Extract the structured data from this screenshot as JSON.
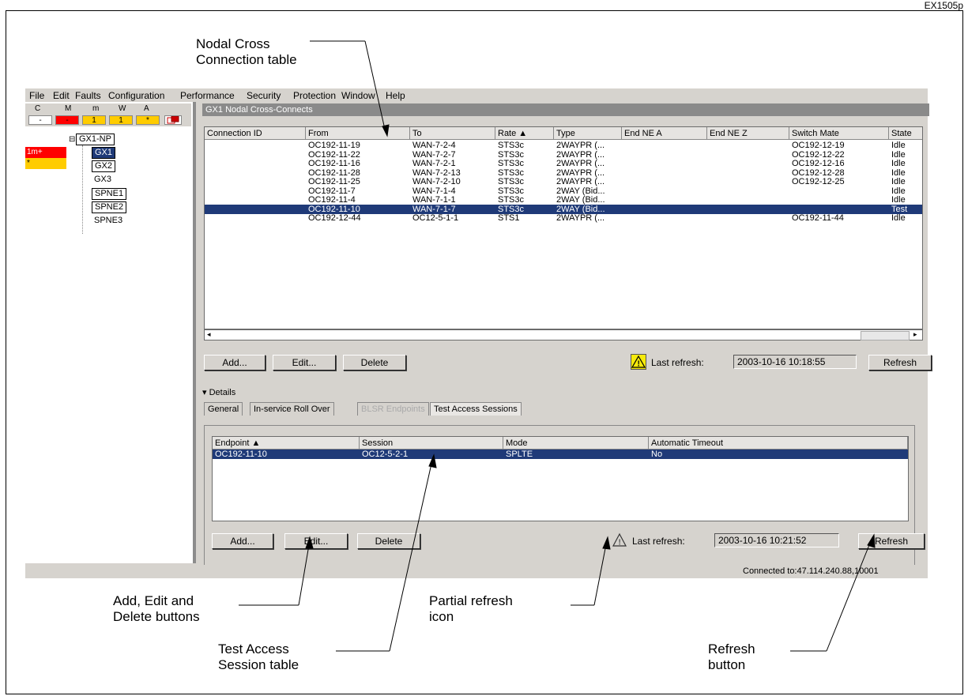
{
  "doc_id": "EX1505p",
  "callouts": {
    "nodal_table": "Nodal Cross\nConnection table",
    "buttons": "Add, Edit and\nDelete buttons",
    "test_access": "Test Access\nSession table",
    "partial_refresh": "Partial refresh\nicon",
    "refresh": "Refresh\nbutton"
  },
  "menu": [
    "File",
    "Edit",
    "Faults",
    "Configuration",
    "Performance",
    "Security",
    "Protection",
    "Window",
    "Help"
  ],
  "alarms": {
    "headers": [
      "C",
      "M",
      "m",
      "W",
      "A"
    ],
    "values": [
      "-",
      "-",
      "1",
      "1",
      "*"
    ],
    "colors": {
      "critical": "#ff0000",
      "minor": "#ffcc00",
      "neutral": "#ffffff"
    }
  },
  "tree": {
    "root": "GX1-NP",
    "children": [
      "GX1",
      "GX2",
      "GX3",
      "SPNE1",
      "SPNE2",
      "SPNE3"
    ],
    "left_labels": [
      "1m+",
      "*"
    ]
  },
  "window_title": "GX1 Nodal Cross-Connects",
  "table1": {
    "headers": [
      "Connection ID",
      "From",
      "To",
      "Rate ▲",
      "Type",
      "End NE A",
      "End NE Z",
      "Switch Mate",
      "State"
    ],
    "rows": [
      [
        "",
        "OC192-11-19",
        "WAN-7-2-4",
        "STS3c",
        "2WAYPR (...",
        "",
        "",
        "OC192-12-19",
        "Idle"
      ],
      [
        "",
        "OC192-11-22",
        "WAN-7-2-7",
        "STS3c",
        "2WAYPR (...",
        "",
        "",
        "OC192-12-22",
        "Idle"
      ],
      [
        "",
        "OC192-11-16",
        "WAN-7-2-1",
        "STS3c",
        "2WAYPR (...",
        "",
        "",
        "OC192-12-16",
        "Idle"
      ],
      [
        "",
        "OC192-11-28",
        "WAN-7-2-13",
        "STS3c",
        "2WAYPR (...",
        "",
        "",
        "OC192-12-28",
        "Idle"
      ],
      [
        "",
        "OC192-11-25",
        "WAN-7-2-10",
        "STS3c",
        "2WAYPR (...",
        "",
        "",
        "OC192-12-25",
        "Idle"
      ],
      [
        "",
        "OC192-11-7",
        "WAN-7-1-4",
        "STS3c",
        "2WAY (Bid...",
        "",
        "",
        "",
        "Idle"
      ],
      [
        "",
        "OC192-11-4",
        "WAN-7-1-1",
        "STS3c",
        "2WAY (Bid...",
        "",
        "",
        "",
        "Idle"
      ],
      [
        "",
        "OC192-11-10",
        "WAN-7-1-7",
        "STS3c",
        "2WAY (Bid...",
        "",
        "",
        "",
        "Test"
      ],
      [
        "",
        "OC192-12-44",
        "OC12-5-1-1",
        "STS1",
        "2WAYPR (...",
        "",
        "",
        "OC192-11-44",
        "Idle"
      ]
    ],
    "selected_row": 7
  },
  "buttons": {
    "add": "Add...",
    "edit": "Edit...",
    "delete": "Delete",
    "refresh": "Refresh"
  },
  "last_refresh_label": "Last refresh:",
  "last_refresh_1": "2003-10-16 10:18:55",
  "details_label": "Details",
  "tabs": [
    "General",
    "In-service Roll Over",
    "BLSR Endpoints",
    "Test Access Sessions"
  ],
  "table2": {
    "headers": [
      "Endpoint ▲",
      "Session",
      "Mode",
      "Automatic Timeout"
    ],
    "rows": [
      [
        "OC192-11-10",
        "OC12-5-2-1",
        "SPLTE",
        "No"
      ]
    ]
  },
  "last_refresh_2": "2003-10-16 10:21:52",
  "status": "Connected to:47.114.240.88,10001"
}
